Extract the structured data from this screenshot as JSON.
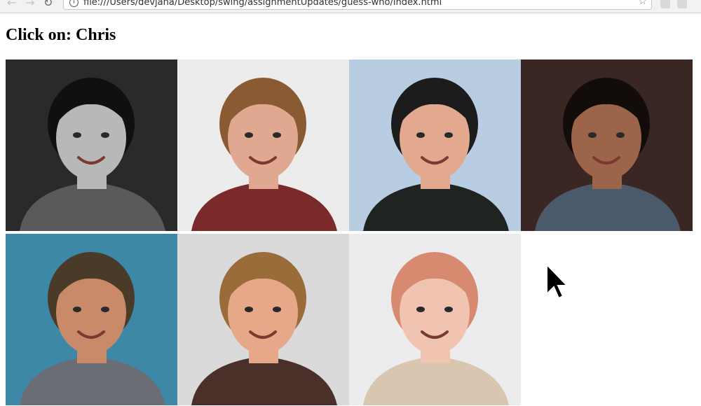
{
  "browser": {
    "url": "file:///Users/devjana/Desktop/swing/assignmentUpdates/guess-who/index.html",
    "back_icon": "arrow-left-icon",
    "forward_icon": "arrow-right-icon",
    "reload_icon": "reload-icon",
    "info_icon": "info-icon",
    "bookmark_icon": "star-icon"
  },
  "page": {
    "heading": "Click on: Chris"
  },
  "photos": [
    {
      "name": "portrait-1",
      "palette": {
        "bg": "#2a2a2a",
        "skin": "#b8b8b8",
        "hair": "#101010",
        "shirt": "#5a5a5a"
      }
    },
    {
      "name": "portrait-2",
      "palette": {
        "bg": "#ececec",
        "skin": "#e0a890",
        "hair": "#8a5a32",
        "shirt": "#7a2a2a"
      }
    },
    {
      "name": "portrait-3",
      "palette": {
        "bg": "#b9cde2",
        "skin": "#e3a98e",
        "hair": "#1c1c1c",
        "shirt": "#1f2420"
      }
    },
    {
      "name": "portrait-4",
      "palette": {
        "bg": "#3a2622",
        "skin": "#9c6448",
        "hair": "#120c0a",
        "shirt": "#4a5a6a"
      }
    },
    {
      "name": "portrait-5",
      "palette": {
        "bg": "#3d88a6",
        "skin": "#c98a6a",
        "hair": "#4a3a28",
        "shirt": "#6a6e74"
      }
    },
    {
      "name": "portrait-6",
      "palette": {
        "bg": "#dadada",
        "skin": "#e6a888",
        "hair": "#9a6c3a",
        "shirt": "#4a3028"
      }
    },
    {
      "name": "portrait-7",
      "palette": {
        "bg": "#ececee",
        "skin": "#f0c4b0",
        "hair": "#d78a70",
        "shirt": "#d8c6b0"
      }
    }
  ],
  "cursor_icon": "mouse-pointer-icon"
}
